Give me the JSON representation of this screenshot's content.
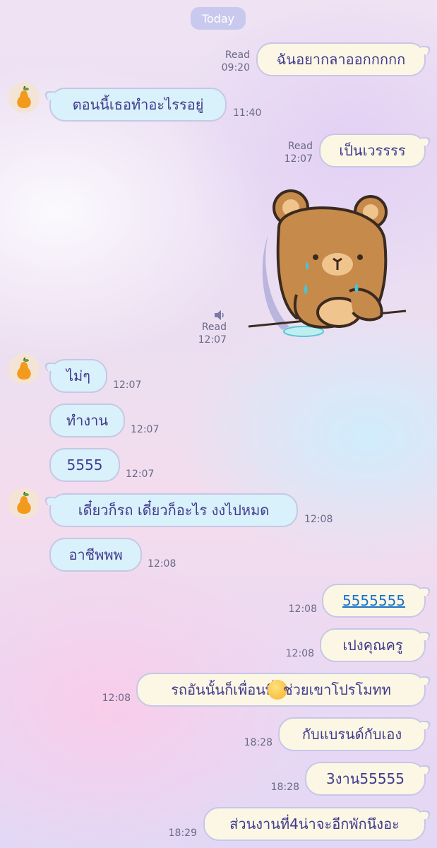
{
  "date_label": "Today",
  "colors": {
    "sent_bubble": "#fbf7e4",
    "received_bubble": "#d9f1fa",
    "text": "#413a8f",
    "link": "#1a73c9"
  },
  "contact_avatar_icon": "pear-icon",
  "messages": [
    {
      "dir": "sent",
      "text": "ฉันอยากลาออกกกกก",
      "read": "Read",
      "time": "09:20"
    },
    {
      "dir": "received",
      "text": "ตอนนี้เธอทำอะไรรอยู่",
      "time": "11:40"
    },
    {
      "dir": "sent",
      "text": "เป็นเวรรรร",
      "read": "Read",
      "time": "12:07"
    },
    {
      "dir": "sent",
      "type": "sticker",
      "sticker": "crying-bear-sticker",
      "sound_icon": "speaker-icon",
      "read": "Read",
      "time": "12:07"
    },
    {
      "dir": "received",
      "text": "ไม่ๆ",
      "time": "12:07"
    },
    {
      "dir": "received",
      "text": "ทำงาน",
      "time": "12:07"
    },
    {
      "dir": "received",
      "text": "5555",
      "time": "12:07"
    },
    {
      "dir": "received",
      "text": "เดี๋ยวก็รถ เดี๋ยวก็อะไร งงไปหมด",
      "time": "12:08"
    },
    {
      "dir": "received",
      "text": "อาชีพพพ",
      "time": "12:08"
    },
    {
      "dir": "sent",
      "text": "5555555",
      "link": true,
      "time": "12:08"
    },
    {
      "dir": "sent",
      "text": "เปงคุณครู",
      "time": "12:08"
    },
    {
      "dir": "sent",
      "text": "รถอันนั้นก็เพื่อนพี่",
      "emoji": "smiling-face-emoji",
      "text_after": "ช่วยเขาโปรโมทท",
      "time": "12:08"
    },
    {
      "dir": "sent",
      "text": "กับแบรนด์กับเอง",
      "time": "18:28"
    },
    {
      "dir": "sent",
      "text": "3งาน55555",
      "time": "18:28"
    },
    {
      "dir": "sent",
      "text": "ส่วนงานที่4น่าจะอีกพักนึงอะ",
      "time": "18:29"
    }
  ]
}
